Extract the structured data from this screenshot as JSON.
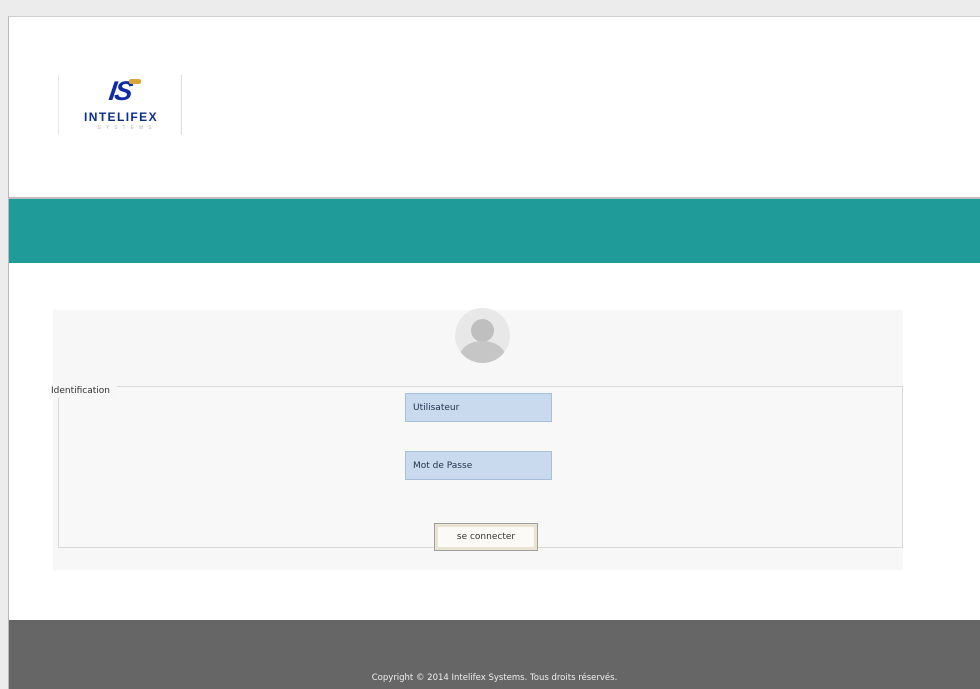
{
  "brand": {
    "logo_mark": "IS",
    "logo_name": "INTELIFEX",
    "logo_subtitle": "SYSTEMS",
    "colors": {
      "teal": "#1f9c9a",
      "footer": "#666666",
      "input_fill": "#c9d9ee",
      "logo_blue": "#0f2aa8"
    }
  },
  "login": {
    "avatar_icon": "user-avatar-icon",
    "legend": "Identification",
    "username_placeholder": "Utilisateur",
    "password_placeholder": "Mot de Passe",
    "submit_label": "se connecter"
  },
  "footer": {
    "copyright": "Copyright © 2014 Intelifex Systems. Tous droits réservés."
  }
}
